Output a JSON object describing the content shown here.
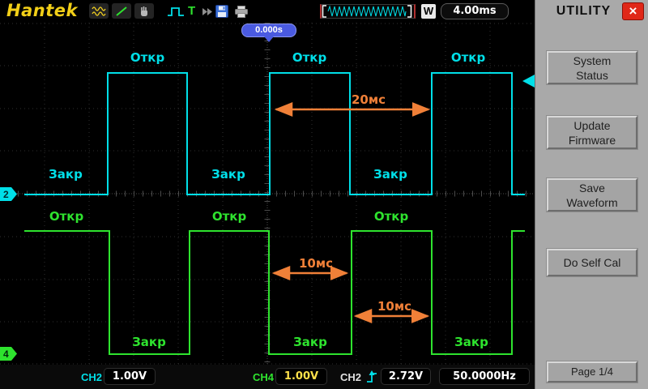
{
  "colors": {
    "ch2": "#00dfe8",
    "ch4": "#2ee32e",
    "annotation": "#f08038",
    "tooltip_bg": "#4a5ae0",
    "logo": "#f2cf18",
    "sidebar_bg": "#a9a9a9",
    "close_red": "#e02818"
  },
  "topbar": {
    "logo": "Hantek",
    "trigger_letter": "T",
    "window_label": "W",
    "timebase": "4.00ms"
  },
  "scope": {
    "time_offset": "0.000s",
    "ch2_marker": "2",
    "ch4_marker": "4",
    "ch2_open_labels": [
      "Откр",
      "Откр",
      "Откр"
    ],
    "ch2_closed_labels": [
      "Закр",
      "Закр",
      "Закр"
    ],
    "ch4_open_labels": [
      "Откр",
      "Откр",
      "Откр"
    ],
    "ch4_closed_labels": [
      "Закр",
      "Закр",
      "Закр"
    ],
    "arrow_period": "20мс",
    "arrow_half_a": "10мс",
    "arrow_half_b": "10мс"
  },
  "statusbar": {
    "ch2_label": "CH2",
    "ch2_volts": "1.00V",
    "ch4_label": "CH4",
    "ch4_volts": "1.00V",
    "trigger_source": "CH2",
    "trigger_level": "2.72V",
    "frequency": "50.0000Hz"
  },
  "sidebar": {
    "title": "UTILITY",
    "close_label": "×",
    "buttons": [
      "System\nStatus",
      "Update\nFirmware",
      "Save\nWaveform",
      "Do Self Cal"
    ],
    "page_button": "Page 1/4"
  }
}
